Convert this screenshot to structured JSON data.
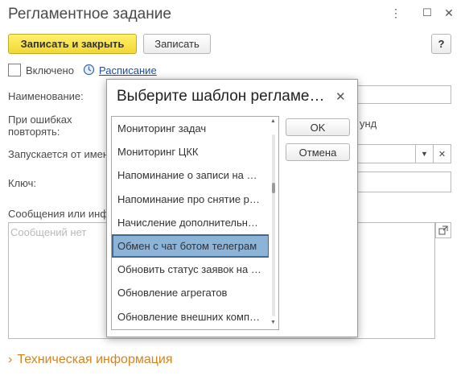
{
  "window": {
    "title": "Регламентное задание",
    "more_glyph": "⋮",
    "maximize_glyph": "☐",
    "close_glyph": "✕"
  },
  "toolbar": {
    "save_close_label": "Записать и закрыть",
    "save_label": "Записать",
    "help_label": "?"
  },
  "form": {
    "enabled_label": "Включено",
    "schedule_label": "Расписание",
    "name_label": "Наименование:",
    "retry_label_line1": "При ошибках",
    "retry_label_line2": "повторять:",
    "retry_suffix": "унд",
    "run_as_label": "Запускается от имен",
    "key_label": "Ключ:",
    "messages_label": "Сообщения или инф",
    "messages_placeholder": "Сообщений нет",
    "tech_info_label": "Техническая информация"
  },
  "dialog": {
    "title": "Выберите шаблон регламе…",
    "close_glyph": "✕",
    "ok_label": "OK",
    "cancel_label": "Отмена",
    "items": [
      "Мониторинг задач",
      "Мониторинг ЦКК",
      "Напоминание о записи на …",
      "Напоминание про снятие р…",
      "Начисление дополнительн…",
      "Обмен с чат ботом телеграм",
      "Обновить статус заявок на …",
      "Обновление агрегатов",
      "Обновление внешних комп…"
    ],
    "selected_index": 5,
    "scroll_position": 0.28
  },
  "colors": {
    "accent_yellow": "#f2d734",
    "selection": "#8db3d6",
    "link": "#1f4f9a",
    "tech_info": "#d4841e"
  }
}
